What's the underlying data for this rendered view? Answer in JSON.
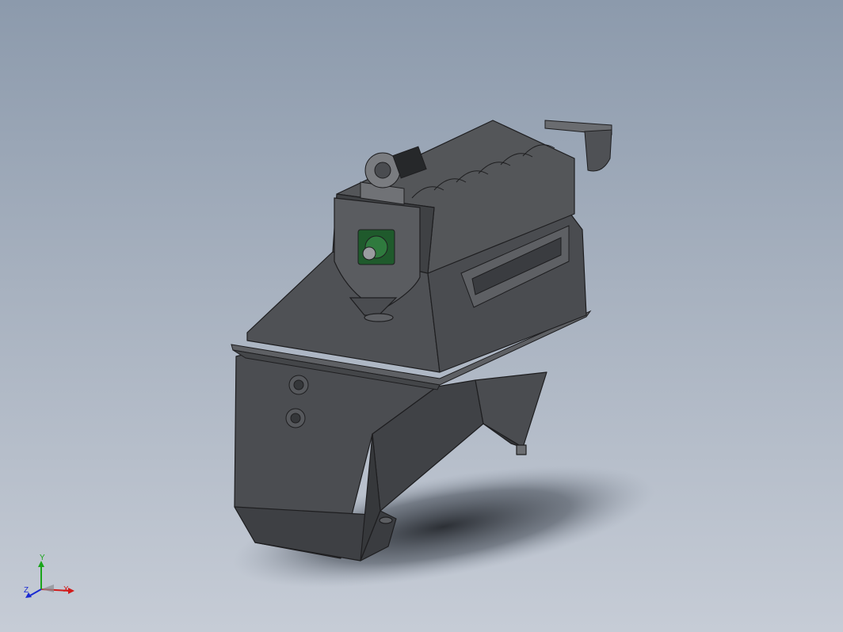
{
  "viewport": {
    "background_top": "#8c9aac",
    "background_bottom": "#c6ccd6",
    "model_color": "#4a4c50",
    "edge_color": "#1e1e20",
    "accent_motor_color": "#1f5a2c"
  },
  "model": {
    "description_icon": "screw-conveyor-hopper-assembly"
  },
  "triad": {
    "x_label": "X",
    "y_label": "Y",
    "z_label": "Z",
    "x_color": "#d21a1a",
    "y_color": "#1aa51a",
    "z_color": "#1a2ad2"
  }
}
